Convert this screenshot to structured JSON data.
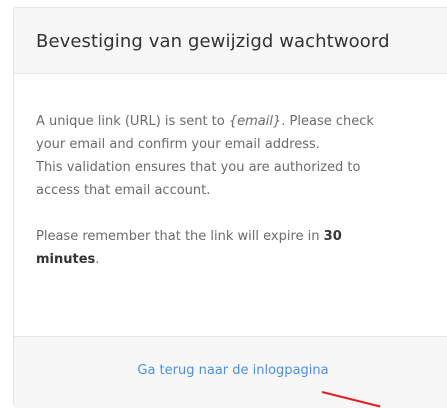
{
  "card": {
    "title": "Bevestiging van gewijzigd wachtwoord",
    "body": {
      "p1_prefix": "A unique link (URL) is sent to ",
      "p1_email": "{email}",
      "p1_line1_suffix": ". Please check",
      "p1_line2": "your email and confirm your email address.",
      "p1_line3": "This validation ensures that you are authorized to",
      "p1_line4": "access that email account.",
      "p2_prefix": "Please remember that the link will expire in ",
      "p2_bold_number": "30",
      "p2_bold_unit": "minutes",
      "p2_suffix": "."
    },
    "footer": {
      "back_link": "Ga terug naar de inlogpagina"
    }
  },
  "colors": {
    "header_bg": "#f7f7f7",
    "link": "#4a90e2",
    "annotation_arrow": "#e02020"
  }
}
